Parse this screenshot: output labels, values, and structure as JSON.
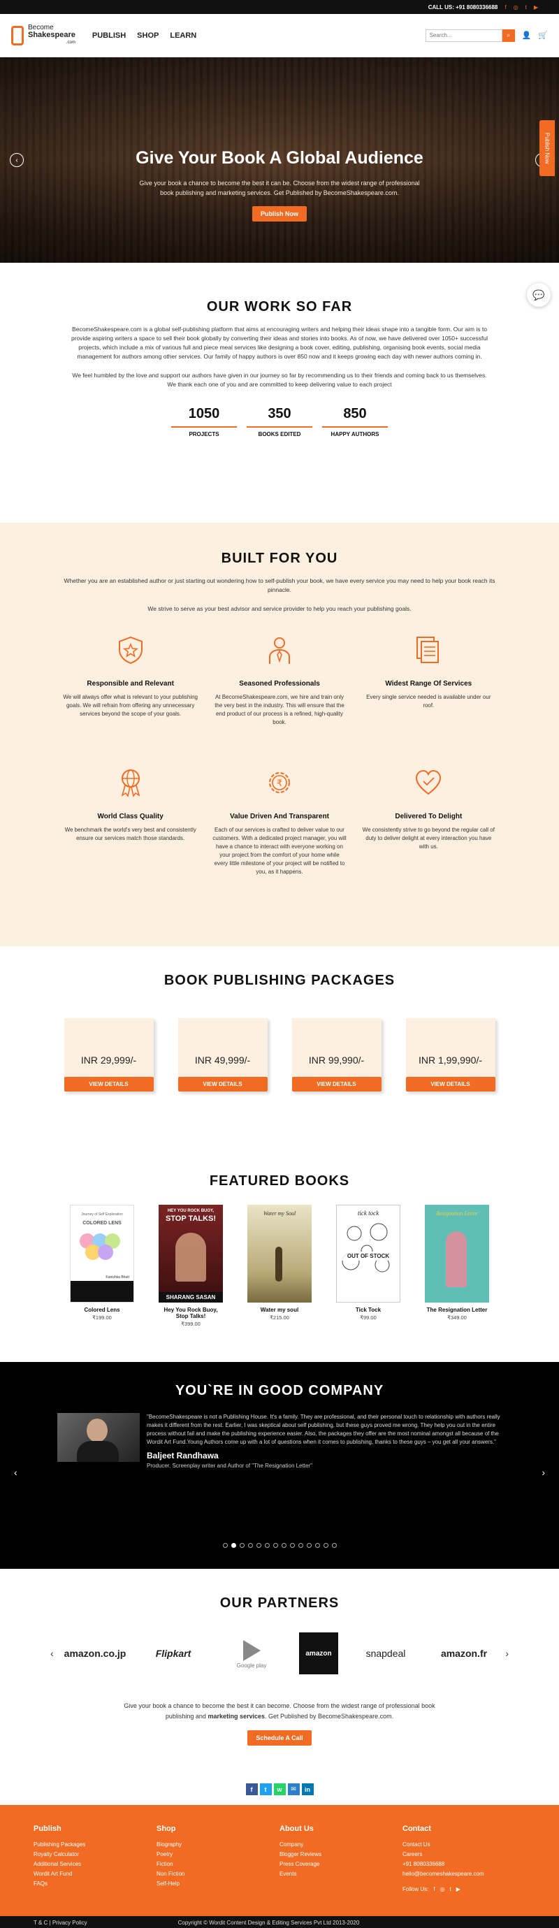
{
  "topbar": {
    "call": "CALL US: +91 8080336688",
    "social_icons": [
      "facebook-icon",
      "instagram-icon",
      "twitter-icon",
      "youtube-icon"
    ]
  },
  "header": {
    "logo_line1": "Become",
    "logo_line2": "Shakespeare",
    "logo_line3": ".com",
    "nav": [
      "PUBLISH",
      "SHOP",
      "LEARN"
    ],
    "search_placeholder": "Search...",
    "accent": "#f26b22"
  },
  "hero": {
    "title": "Give Your Book A Global Audience",
    "text": "Give your book a chance to become the best it can be. Choose from the widest range of professional book publishing and marketing services. Get Published by BecomeShakespeare.com.",
    "cta": "Publish Now",
    "side_tab": "Publish Now"
  },
  "work": {
    "title": "OUR WORK SO FAR",
    "para1": "BecomeShakespeare.com is a global self-publishing platform that aims at encouraging writers and helping their ideas shape into a tangible form. Our aim is to provide aspiring writers a space to sell their book globally by converting their ideas and stories into books. As of now, we have delivered over 1050+ successful projects, which include a mix of various full and piece meal services like designing a book cover, editing, publishing, organising book events, social media management for authors among other services. Our family of happy authors is over 850 now and it keeps growing each day with newer authors coming in.",
    "para2": "We feel humbled by the love and support our authors have given in our journey so far by recommending us to their friends and coming back to us themselves. We thank each one of you and are committed to keep delivering value to each project",
    "stats": [
      {
        "num": "1050",
        "label": "PROJECTS"
      },
      {
        "num": "350",
        "label": "BOOKS EDITED"
      },
      {
        "num": "850",
        "label": "HAPPY AUTHORS"
      }
    ]
  },
  "built": {
    "title": "BUILT FOR YOU",
    "para1": "Whether you are an established author or just starting out wondering how to self-publish your book, we have every service you may need to help your book reach its pinnacle.",
    "para2": "We strive to serve as your best advisor and service provider to help you reach your publishing goals.",
    "features": [
      {
        "title": "Responsible and Relevant",
        "text": "We will always offer what is relevant to your publishing goals. We will refrain from offering any unnecessary services beyond the scope of your goals.",
        "icon": "shield-star-icon"
      },
      {
        "title": "Seasoned Professionals",
        "text": "At BecomeShakespeare.com, we hire and train only the very best in the industry. This will ensure that the end product of our process is a refined, high-quality book.",
        "icon": "professional-icon"
      },
      {
        "title": "Widest Range Of Services",
        "text": "Every single service needed is available under our roof.",
        "icon": "documents-icon"
      },
      {
        "title": "World Class Quality",
        "text": "We benchmark the world's very best and consistently ensure our services match those standards.",
        "icon": "globe-medal-icon"
      },
      {
        "title": "Value Driven And Transparent",
        "text": "Each of our services is crafted to deliver value to our customers. With a dedicated project manager, you will have a chance to interact with everyone working on your project from the comfort of your home while every little milestone of your project will be notified to you, as it happens.",
        "icon": "rupee-gear-icon"
      },
      {
        "title": "Delivered To Delight",
        "text": "We consistently strive to go beyond the regular call of duty to deliver delight at every interaction you have with us.",
        "icon": "heart-icon"
      }
    ]
  },
  "packages": {
    "title": "BOOK PUBLISHING PACKAGES",
    "items": [
      {
        "price": "INR 29,999/-",
        "cta": "VIEW DETAILS"
      },
      {
        "price": "INR 49,999/-",
        "cta": "VIEW DETAILS"
      },
      {
        "price": "INR 99,990/-",
        "cta": "VIEW DETAILS"
      },
      {
        "price": "INR 1,99,990/-",
        "cta": "VIEW DETAILS"
      }
    ]
  },
  "books": {
    "title": "FEATURED BOOKS",
    "items": [
      {
        "title": "Colored Lens",
        "price": "₹199.00",
        "cover_text": "COLORED LENS",
        "cover_sub": "Journey of Self Exploration",
        "cover_author": "Kanishka Bhatt"
      },
      {
        "title": "Hey You Rock Buoy, Stop Talks!",
        "price": "₹399.00",
        "cover_text": "STOP TALKS!",
        "cover_sub": "HEY YOU ROCK BUOY,",
        "cover_author": "SHARANG SASAN"
      },
      {
        "title": "Water my soul",
        "price": "₹215.00",
        "cover_text": "Water my Soul"
      },
      {
        "title": "Tick Tock",
        "price": "₹99.00",
        "cover_text": "tick tock",
        "badge": "OUT OF STOCK"
      },
      {
        "title": "The Resignation Letter",
        "price": "₹349.00",
        "cover_text": "Resignation Letter"
      }
    ]
  },
  "testimonial": {
    "title": "YOU`RE IN GOOD COMPANY",
    "quote": "\"BecomeShakespeare is not a Publishing House. It's a family. They are professional, and their personal touch to relationship with authors really makes it different from the rest. Earlier, I was skeptical about self publishing, but these guys proved me wrong. They help you out in the entire process without fail and make the publishing experience easier. Also, the packages they offer are the most nominal amongst all because of the Wordit Art Fund.Young Authors come up with a lot of questions when it comes to publishing, thanks to these guys – you get all your answers.\"",
    "name": "Baljeet Randhawa",
    "role": "Producer, Screenplay writer and Author of \"The Resignation Letter\"",
    "dot_count": 14,
    "active_dot": 1
  },
  "partners": {
    "title": "OUR PARTNERS",
    "logos": [
      "amazon.co.jp",
      "Flipkart",
      "Google play",
      "amazon",
      "snapdeal",
      "amazon.fr"
    ],
    "text_before": "Give your book a chance to become the best it can become. Choose from the widest range of professional book publishing and ",
    "text_bold": "marketing services",
    "text_after": ". Get Published by BecomeShakespeare.com.",
    "cta": "Schedule A Call"
  },
  "share": [
    {
      "icon": "facebook-icon",
      "glyph": "f",
      "color": "#3b5998"
    },
    {
      "icon": "twitter-icon",
      "glyph": "t",
      "color": "#1da1f2"
    },
    {
      "icon": "whatsapp-icon",
      "glyph": "w",
      "color": "#25d366"
    },
    {
      "icon": "email-icon",
      "glyph": "✉",
      "color": "#2c80c9"
    },
    {
      "icon": "linkedin-icon",
      "glyph": "in",
      "color": "#0077b5"
    }
  ],
  "footer": {
    "cols": [
      {
        "title": "Publish",
        "links": [
          "Publishing Packages",
          "Royalty Calculator",
          "Additional Services",
          "Wordit Art Fund",
          "FAQs"
        ]
      },
      {
        "title": "Shop",
        "links": [
          "Biography",
          "Poetry",
          "Fiction",
          "Non Fiction",
          "Self-Help"
        ]
      },
      {
        "title": "About Us",
        "links": [
          "Company",
          "Blogger Reviews",
          "Press Coverage",
          "Events"
        ]
      },
      {
        "title": "Contact",
        "links": [
          "Contact Us",
          "Careers",
          "+91 8080336688",
          "hello@becomeshakespeare.com"
        ]
      }
    ],
    "follow": "Follow Us:",
    "terms": "T & C | Privacy Policy",
    "copyright": "Copyright © Wordit Content Design & Editing Services Pvt Ltd 2013-2020"
  }
}
